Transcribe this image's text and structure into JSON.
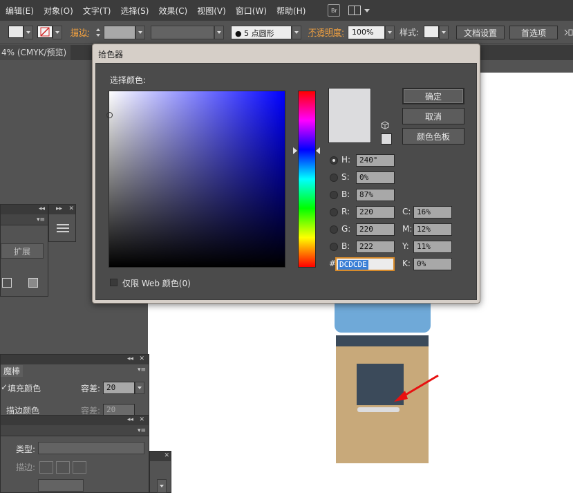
{
  "menubar": {
    "items": [
      "编辑(E)",
      "对象(O)",
      "文字(T)",
      "选择(S)",
      "效果(C)",
      "视图(V)",
      "窗口(W)",
      "帮助(H)"
    ],
    "br_label": "Br"
  },
  "controlbar": {
    "stroke_label": "描边:",
    "brush_label": "5 点圆形",
    "opacity_label": "不透明度:",
    "opacity_value": "100%",
    "style_label": "样式:",
    "doc_settings": "文档设置",
    "preferences": "首选项"
  },
  "document_tab": {
    "label": "4% (CMYK/预览)"
  },
  "panels": {
    "expand_label": "扩展",
    "magic_wand": {
      "title": "魔棒",
      "fill_color_label": "填充颜色",
      "tolerance_label": "容差:",
      "tolerance_value": "20",
      "stroke_color_label": "描边颜色",
      "tolerance2_label": "容差:",
      "tolerance2_value": "20"
    },
    "lower": {
      "type_label": "类型:",
      "stroke_label": "描边:"
    }
  },
  "color_picker": {
    "title": "拾色器",
    "select_color_label": "选择颜色:",
    "buttons": {
      "ok": "确定",
      "cancel": "取消",
      "swatches": "颜色色板"
    },
    "hsb": [
      {
        "label": "H:",
        "value": "240°",
        "selected": true
      },
      {
        "label": "S:",
        "value": "0%",
        "selected": false
      },
      {
        "label": "B:",
        "value": "87%",
        "selected": false
      }
    ],
    "rgb": [
      {
        "label": "R:",
        "value": "220"
      },
      {
        "label": "G:",
        "value": "220"
      },
      {
        "label": "B:",
        "value": "222"
      }
    ],
    "cmyk": [
      {
        "label": "C:",
        "value": "16%"
      },
      {
        "label": "M:",
        "value": "12%"
      },
      {
        "label": "Y:",
        "value": "11%"
      },
      {
        "label": "K:",
        "value": "0%"
      }
    ],
    "hex_prefix": "#",
    "hex_value": "DCDCDE",
    "web_only_label": "仅限 Web 颜色(0)",
    "current_color": "#dcdcde"
  },
  "colors": {
    "accent_orange": "#f0a040",
    "artwork_blue": "#6fa9d8",
    "artwork_dark": "#3b4a5a",
    "artwork_tan": "#c8a97a",
    "arrow_red": "#e81010"
  }
}
